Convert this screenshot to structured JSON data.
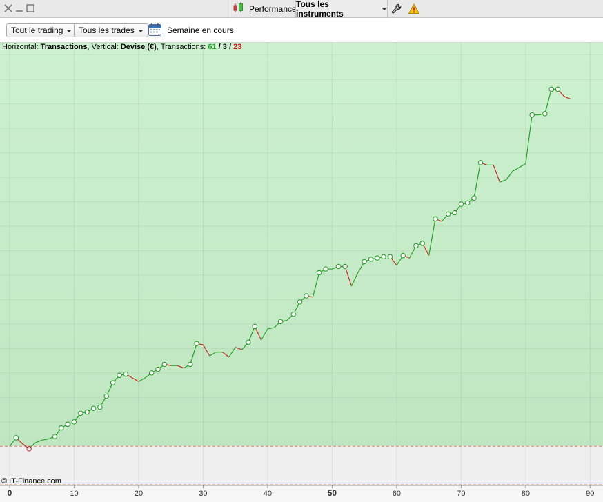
{
  "titlebar": {
    "performance_label": "Performance",
    "instruments_label": "Tous les instruments",
    "icons": [
      "close-icon",
      "minimize-icon",
      "maximize-icon",
      "candlestick-icon",
      "wrench-icon",
      "warning-icon"
    ]
  },
  "toolbar": {
    "trading_filter": "Tout le trading",
    "trades_filter": "Tous les trades",
    "period_label": "Semaine en cours",
    "calendar_icon": "calendar-icon"
  },
  "info": {
    "horizontal_prefix": "Horizontal: ",
    "horizontal_value": "Transactions",
    "vertical_prefix": ", Vertical: ",
    "vertical_value": "Devise (€)",
    "transactions_prefix": ", Transactions: ",
    "wins": "61",
    "sep1": " / ",
    "neutral": "3",
    "sep2": " / ",
    "losses": "23"
  },
  "copyright": "© IT-Finance.com",
  "colors": {
    "profit_zone_top": "#cdf1d0",
    "profit_zone_bottom": "#bfe6c1",
    "loss_zone": "#efefef",
    "up_line": "#1c9a1c",
    "down_line": "#cc1a1a",
    "baseline": "#1a1aa8",
    "zero_dashed": "#e08080"
  },
  "chart_data": {
    "type": "line",
    "xlabel": "Transactions",
    "ylabel": "Devise (€)",
    "xlim": [
      -1.5,
      92
    ],
    "x_ticks": [
      0,
      10,
      20,
      30,
      40,
      50,
      60,
      70,
      80,
      90
    ],
    "x_ticks_bold": [
      0,
      50
    ],
    "y_axis_labels_shown": false,
    "grid": true,
    "note_y_units": "relative units (no y tick labels shown)",
    "ylim": [
      -32,
      330
    ],
    "zones": {
      "profit_above": 0,
      "baseline": -30
    },
    "equity": [
      {
        "x": 0,
        "y": 0,
        "m": 0
      },
      {
        "x": 1,
        "y": 7,
        "m": 1
      },
      {
        "x": 2,
        "y": 2,
        "m": 0
      },
      {
        "x": 3,
        "y": -2,
        "m": 1
      },
      {
        "x": 4,
        "y": 3,
        "m": 0
      },
      {
        "x": 5,
        "y": 5,
        "m": 0
      },
      {
        "x": 6,
        "y": 6,
        "m": 0
      },
      {
        "x": 7,
        "y": 8,
        "m": 1
      },
      {
        "x": 8,
        "y": 15,
        "m": 1
      },
      {
        "x": 9,
        "y": 18,
        "m": 1
      },
      {
        "x": 10,
        "y": 20,
        "m": 1
      },
      {
        "x": 11,
        "y": 27,
        "m": 1
      },
      {
        "x": 12,
        "y": 28,
        "m": 1
      },
      {
        "x": 13,
        "y": 31,
        "m": 1
      },
      {
        "x": 14,
        "y": 32,
        "m": 1
      },
      {
        "x": 15,
        "y": 41,
        "m": 1
      },
      {
        "x": 16,
        "y": 52,
        "m": 1
      },
      {
        "x": 17,
        "y": 58,
        "m": 1
      },
      {
        "x": 18,
        "y": 59,
        "m": 1
      },
      {
        "x": 19,
        "y": 56,
        "m": 0
      },
      {
        "x": 20,
        "y": 53,
        "m": 0
      },
      {
        "x": 21,
        "y": 56,
        "m": 0
      },
      {
        "x": 22,
        "y": 60,
        "m": 1
      },
      {
        "x": 23,
        "y": 63,
        "m": 1
      },
      {
        "x": 24,
        "y": 67,
        "m": 1
      },
      {
        "x": 25,
        "y": 66,
        "m": 0
      },
      {
        "x": 26,
        "y": 66,
        "m": 0
      },
      {
        "x": 27,
        "y": 64,
        "m": 0
      },
      {
        "x": 28,
        "y": 67,
        "m": 1
      },
      {
        "x": 29,
        "y": 84,
        "m": 1
      },
      {
        "x": 30,
        "y": 83,
        "m": 0
      },
      {
        "x": 31,
        "y": 74,
        "m": 0
      },
      {
        "x": 32,
        "y": 77,
        "m": 0
      },
      {
        "x": 33,
        "y": 77,
        "m": 0
      },
      {
        "x": 34,
        "y": 73,
        "m": 0
      },
      {
        "x": 35,
        "y": 81,
        "m": 0
      },
      {
        "x": 36,
        "y": 79,
        "m": 0
      },
      {
        "x": 37,
        "y": 85,
        "m": 1
      },
      {
        "x": 38,
        "y": 98,
        "m": 1
      },
      {
        "x": 39,
        "y": 87,
        "m": 0
      },
      {
        "x": 40,
        "y": 96,
        "m": 0
      },
      {
        "x": 41,
        "y": 97,
        "m": 0
      },
      {
        "x": 42,
        "y": 102,
        "m": 1
      },
      {
        "x": 43,
        "y": 103,
        "m": 0
      },
      {
        "x": 44,
        "y": 108,
        "m": 1
      },
      {
        "x": 45,
        "y": 118,
        "m": 1
      },
      {
        "x": 46,
        "y": 123,
        "m": 1
      },
      {
        "x": 47,
        "y": 122,
        "m": 0
      },
      {
        "x": 48,
        "y": 142,
        "m": 1
      },
      {
        "x": 49,
        "y": 145,
        "m": 1
      },
      {
        "x": 50,
        "y": 145,
        "m": 0
      },
      {
        "x": 51,
        "y": 147,
        "m": 1
      },
      {
        "x": 52,
        "y": 147,
        "m": 1
      },
      {
        "x": 53,
        "y": 131,
        "m": 0
      },
      {
        "x": 54,
        "y": 142,
        "m": 0
      },
      {
        "x": 55,
        "y": 151,
        "m": 1
      },
      {
        "x": 56,
        "y": 153,
        "m": 1
      },
      {
        "x": 57,
        "y": 154,
        "m": 1
      },
      {
        "x": 58,
        "y": 155,
        "m": 1
      },
      {
        "x": 59,
        "y": 155,
        "m": 1
      },
      {
        "x": 60,
        "y": 148,
        "m": 0
      },
      {
        "x": 61,
        "y": 156,
        "m": 1
      },
      {
        "x": 62,
        "y": 154,
        "m": 0
      },
      {
        "x": 63,
        "y": 164,
        "m": 1
      },
      {
        "x": 64,
        "y": 166,
        "m": 1
      },
      {
        "x": 65,
        "y": 156,
        "m": 0
      },
      {
        "x": 66,
        "y": 186,
        "m": 1
      },
      {
        "x": 67,
        "y": 184,
        "m": 0
      },
      {
        "x": 68,
        "y": 190,
        "m": 1
      },
      {
        "x": 69,
        "y": 191,
        "m": 1
      },
      {
        "x": 70,
        "y": 198,
        "m": 1
      },
      {
        "x": 71,
        "y": 199,
        "m": 1
      },
      {
        "x": 72,
        "y": 203,
        "m": 1
      },
      {
        "x": 73,
        "y": 232,
        "m": 1
      },
      {
        "x": 74,
        "y": 230,
        "m": 0
      },
      {
        "x": 75,
        "y": 230,
        "m": 0
      },
      {
        "x": 76,
        "y": 216,
        "m": 0
      },
      {
        "x": 77,
        "y": 218,
        "m": 0
      },
      {
        "x": 78,
        "y": 225,
        "m": 0
      },
      {
        "x": 79,
        "y": 228,
        "m": 0
      },
      {
        "x": 80,
        "y": 231,
        "m": 0
      },
      {
        "x": 81,
        "y": 271,
        "m": 1
      },
      {
        "x": 82,
        "y": 271,
        "m": 0
      },
      {
        "x": 83,
        "y": 272,
        "m": 1
      },
      {
        "x": 84,
        "y": 292,
        "m": 1
      },
      {
        "x": 85,
        "y": 292,
        "m": 1
      },
      {
        "x": 86,
        "y": 286,
        "m": 0
      },
      {
        "x": 87,
        "y": 284,
        "m": 0
      }
    ]
  }
}
